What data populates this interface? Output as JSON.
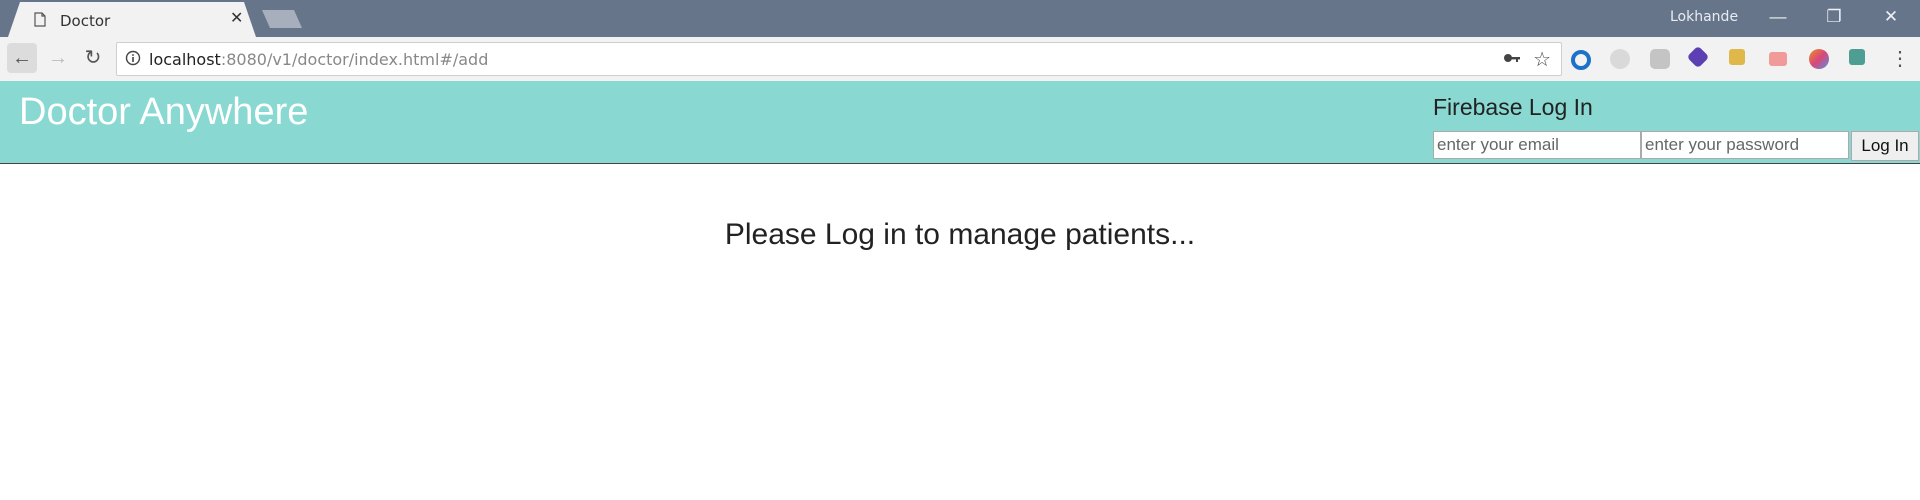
{
  "browser": {
    "tab_title": "Doctor",
    "tab_close": "✕",
    "profile_name": "Lokhande",
    "window_controls": {
      "minimize": "—",
      "restore": "❐",
      "close": "✕"
    },
    "nav": {
      "back": "←",
      "forward": "→",
      "reload": "↻"
    },
    "url": {
      "host": "localhost",
      "path": ":8080/v1/doctor/index.html#/add"
    },
    "icons": {
      "key": "key-icon",
      "star": "☆",
      "menu": "⋮"
    },
    "extensions": [
      {
        "name": "extension-1-icon",
        "color": "#1a73c9"
      },
      {
        "name": "extension-2-icon",
        "color": "#bdbdbd"
      },
      {
        "name": "extension-3-icon",
        "color": "#a9a9a9"
      },
      {
        "name": "extension-4-icon",
        "color": "#5b3fb3"
      },
      {
        "name": "extension-5-icon",
        "color": "#e0b84a"
      },
      {
        "name": "extension-6-icon",
        "color": "#f19a9a"
      },
      {
        "name": "extension-7-icon",
        "color": "#e8902b"
      },
      {
        "name": "extension-8-icon",
        "color": "#4f9e93"
      }
    ]
  },
  "header": {
    "app_title": "Doctor Anywhere",
    "background": "#89d9d2",
    "login": {
      "title": "Firebase Log In",
      "email_placeholder": "enter your email",
      "password_placeholder": "enter your password",
      "button_label": "Log In"
    }
  },
  "main": {
    "message": "Please Log in to manage patients..."
  }
}
